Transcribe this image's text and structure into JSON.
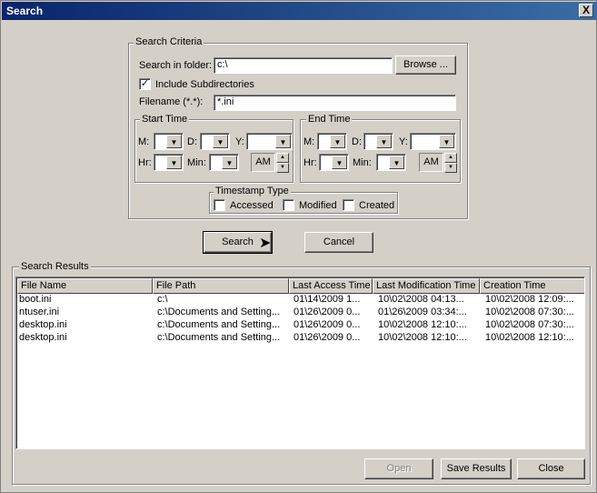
{
  "window": {
    "title": "Search",
    "close_glyph": "X"
  },
  "criteria": {
    "legend": "Search Criteria",
    "folder_label": "Search in folder:",
    "folder_value": "c:\\",
    "browse_label": "Browse ...",
    "include_subdirs_label": "Include Subdirectories",
    "include_subdirs_checked": true,
    "filename_label": "Filename (*.*):",
    "filename_value": "*.ini"
  },
  "start_time": {
    "legend": "Start Time",
    "m": "M:",
    "d": "D:",
    "y": "Y:",
    "hr": "Hr:",
    "min": "Min:",
    "ampm": "AM"
  },
  "end_time": {
    "legend": "End Time",
    "m": "M:",
    "d": "D:",
    "y": "Y:",
    "hr": "Hr:",
    "min": "Min:",
    "ampm": "AM"
  },
  "timestamp": {
    "legend": "Timestamp Type",
    "accessed": "Accessed",
    "modified": "Modified",
    "created": "Created"
  },
  "actions": {
    "search": "Search",
    "cancel": "Cancel"
  },
  "results": {
    "legend": "Search Results",
    "columns": [
      "File Name",
      "File Path",
      "Last Access Time",
      "Last Modification Time",
      "Creation Time"
    ],
    "rows": [
      [
        "boot.ini",
        "c:\\",
        "01\\14\\2009 1...",
        "10\\02\\2008 04:13...",
        "10\\02\\2008 12:09:..."
      ],
      [
        "ntuser.ini",
        "c:\\Documents and Setting...",
        "01\\26\\2009 0...",
        "01\\26\\2009 03:34:...",
        "10\\02\\2008 07:30:..."
      ],
      [
        "desktop.ini",
        "c:\\Documents and Setting...",
        "01\\26\\2009 0...",
        "10\\02\\2008 12:10:...",
        "10\\02\\2008 07:30:..."
      ],
      [
        "desktop.ini",
        "c:\\Documents and Setting...",
        "01\\26\\2009 0...",
        "10\\02\\2008 12:10:...",
        "10\\02\\2008 12:10:..."
      ]
    ]
  },
  "footer": {
    "open": "Open",
    "save": "Save Results",
    "close": "Close"
  }
}
